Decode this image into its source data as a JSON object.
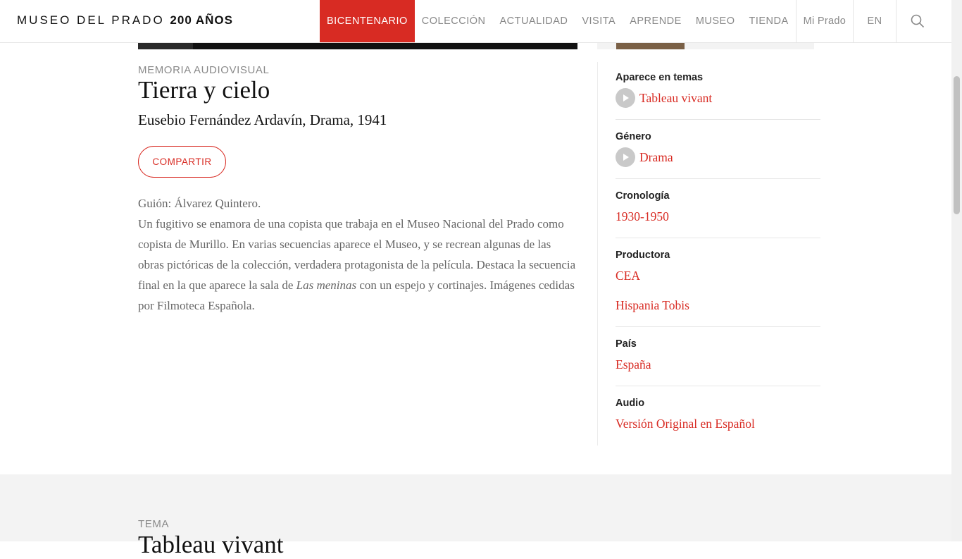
{
  "header": {
    "logo_main": "MUSEO DEL PRADO",
    "logo_bold": "200 AÑOS",
    "nav": [
      {
        "label": "BICENTENARIO",
        "active": true
      },
      {
        "label": "COLECCIÓN"
      },
      {
        "label": "ACTUALIDAD"
      },
      {
        "label": "VISITA"
      },
      {
        "label": "APRENDE"
      },
      {
        "label": "MUSEO"
      },
      {
        "label": "TIENDA"
      }
    ],
    "account": "Mi Prado",
    "language": "EN",
    "accent_color": "#d82b23"
  },
  "main": {
    "eyebrow": "MEMORIA AUDIOVISUAL",
    "title": "Tierra y cielo",
    "subtitle": "Eusebio Fernández Ardavín, Drama, 1941",
    "share_label": "COMPARTIR",
    "description": {
      "line1": "Guión: Álvarez Quintero.",
      "body_before": "Un fugitivo se enamora de una copista que trabaja en el Museo Nacional del Prado como copista de Murillo. En varias secuencias aparece el Museo, y se recrean algunas de las obras pictóricas de la colección, verdadera protagonista de la película. Destaca la secuencia final en la que aparece la sala de ",
      "body_italic": "Las meninas",
      "body_after": " con un espejo y cortinajes. Imágenes cedidas por Filmoteca Española."
    }
  },
  "sidebar": {
    "temas": {
      "label": "Aparece en temas",
      "value": "Tableau vivant"
    },
    "genero": {
      "label": "Género",
      "value": "Drama"
    },
    "cronologia": {
      "label": "Cronología",
      "value": "1930-1950"
    },
    "productora": {
      "label": "Productora",
      "values": [
        "CEA",
        "Hispania Tobis"
      ]
    },
    "pais": {
      "label": "País",
      "value": "España"
    },
    "audio": {
      "label": "Audio",
      "value": "Versión Original en Español"
    }
  },
  "tema": {
    "eyebrow": "TEMA",
    "title": "Tableau vivant"
  }
}
